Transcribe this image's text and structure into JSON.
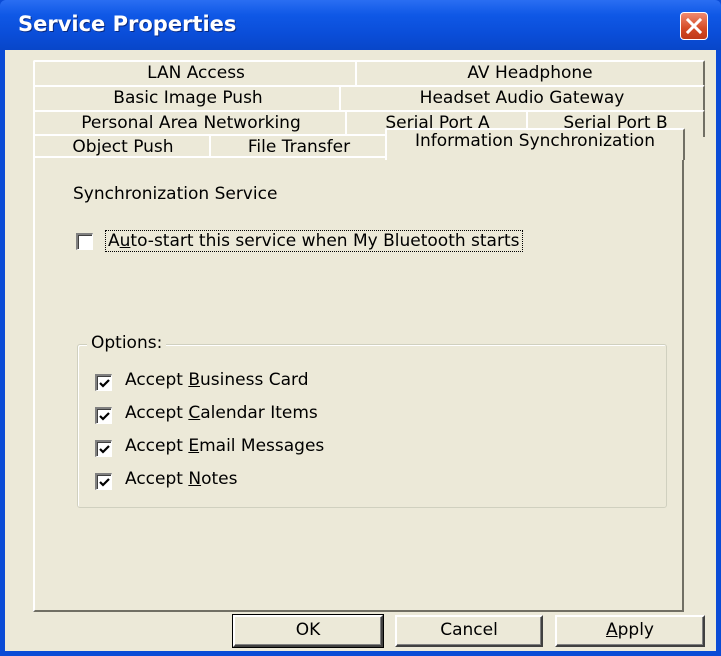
{
  "window": {
    "title": "Service Properties"
  },
  "tabs": [
    {
      "label": "LAN Access"
    },
    {
      "label": "AV Headphone"
    },
    {
      "label": "Basic Image Push"
    },
    {
      "label": "Headset Audio Gateway"
    },
    {
      "label": "Personal Area Networking"
    },
    {
      "label": "Serial Port A"
    },
    {
      "label": "Serial Port B"
    },
    {
      "label": "Object Push"
    },
    {
      "label": "File Transfer"
    },
    {
      "label": "Information Synchronization"
    }
  ],
  "active_tab": "Information Synchronization",
  "panel": {
    "heading": "Synchronization Service",
    "autostart": {
      "pre": "",
      "mnemonic": "u",
      "post": "to-start this service when My Bluetooth starts",
      "first": "A",
      "checked": false
    },
    "options": {
      "legend": "Options:",
      "items": [
        {
          "pre": "Accept ",
          "mnemonic": "B",
          "post": "usiness Card",
          "checked": true
        },
        {
          "pre": "Accept ",
          "mnemonic": "C",
          "post": "alendar Items",
          "checked": true
        },
        {
          "pre": "Accept ",
          "mnemonic": "E",
          "post": "mail Messages",
          "checked": true
        },
        {
          "pre": "Accept ",
          "mnemonic": "N",
          "post": "otes",
          "checked": true
        }
      ]
    }
  },
  "buttons": {
    "ok": "OK",
    "cancel": "Cancel",
    "apply_mnemonic": "A",
    "apply_rest": "pply"
  },
  "icons": {
    "close": "close-icon",
    "checkmark": "checkmark-icon"
  },
  "colors": {
    "titlebar": "#0a4dd8",
    "face": "#ece9d8",
    "close": "#d44a24"
  }
}
